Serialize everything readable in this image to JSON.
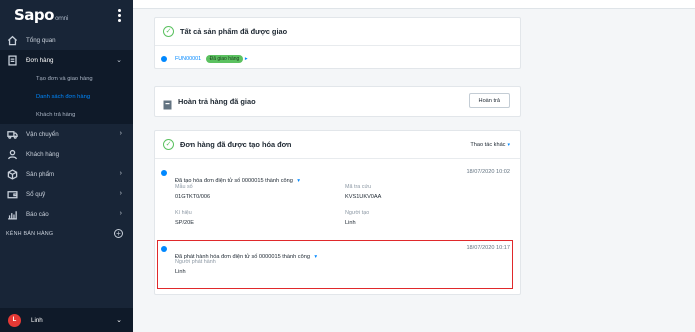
{
  "sidebar": {
    "logo": "Sapo",
    "logo_sub": "omni",
    "items": [
      {
        "label": "Tổng quan",
        "icon": "home-icon"
      },
      {
        "label": "Đơn hàng",
        "icon": "order-icon"
      },
      {
        "label": "Vận chuyển",
        "icon": "truck-icon"
      },
      {
        "label": "Khách hàng",
        "icon": "user-icon"
      },
      {
        "label": "Sản phẩm",
        "icon": "box-icon"
      },
      {
        "label": "Sổ quỹ",
        "icon": "wallet-icon"
      },
      {
        "label": "Báo cáo",
        "icon": "chart-icon"
      }
    ],
    "sub_items": [
      "Tạo đơn và giao hàng",
      "Danh sách đơn hàng",
      "Khách trả hàng"
    ],
    "channels_label": "KÊNH BÁN HÀNG",
    "user": {
      "initial": "L",
      "name": "Linh"
    }
  },
  "card1": {
    "title": "Tất cả sản phẩm đã được giao",
    "fulfillment_code": "FUN00001",
    "status_badge": "Đã giao hàng",
    "arrow": "▸"
  },
  "card2": {
    "title": "Hoàn trả hàng đã giao",
    "button": "Hoàn trả"
  },
  "card3": {
    "title": "Đơn hàng đã được tạo hóa đơn",
    "more_actions": "Thao tác khác",
    "event1": {
      "title": "Đã tạo hóa đơn điện tử số 0000015 thành công",
      "time": "18/07/2020 10:02",
      "fields": {
        "form_no_label": "Mẫu số",
        "form_no": "01GTKT0/006",
        "lookup_label": "Mã tra cứu",
        "lookup": "KVS1UKV0AA",
        "symbol_label": "Kí hiệu",
        "symbol": "SP/20E",
        "creator_label": "Người tạo",
        "creator": "Linh"
      }
    },
    "event2": {
      "title": "Đã phát hành hóa đơn điện tử số 0000015 thành công",
      "time": "18/07/2020 10:17",
      "issuer_label": "Người phát hành",
      "issuer": "Linh"
    }
  },
  "colors": {
    "sidebar": "#182537",
    "accent": "#0088ff",
    "success": "#5bc160",
    "highlight": "#e0292b"
  }
}
